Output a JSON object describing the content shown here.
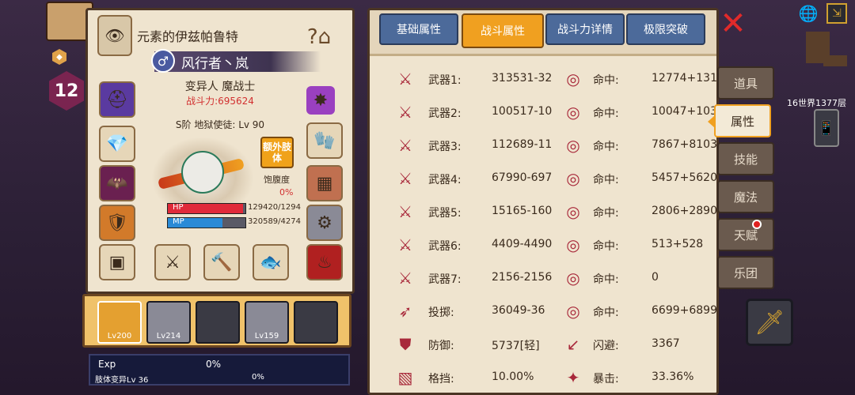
{
  "character": {
    "name": "元素的伊兹帕鲁特",
    "class": "风行者丶岚",
    "race": "变异人 魔战士",
    "power_label": "战斗力:695624",
    "rank": "S阶 地狱使徒: Lv 90",
    "extra_limb_label": "额外肢体",
    "satiety_label": "饱腹度",
    "satiety_value": "0%",
    "hp_label": "HP",
    "hp_value": "129420/1294",
    "hp_fraction": 0.97,
    "mp_label": "MP",
    "mp_value": "320589/4274",
    "mp_fraction": 0.7
  },
  "team": [
    {
      "level": "Lv200",
      "state": "active"
    },
    {
      "level": "Lv214",
      "state": "filled"
    },
    {
      "level": "",
      "state": "empty"
    },
    {
      "level": "Lv159",
      "state": "filled"
    },
    {
      "level": "",
      "state": "empty"
    }
  ],
  "exp": {
    "label": "Exp",
    "value": "0%",
    "sub_label": "肢体变异Lv 36",
    "sub_value": "0%"
  },
  "tabs": [
    {
      "label": "基础属性",
      "active": false
    },
    {
      "label": "战斗属性",
      "active": true
    },
    {
      "label": "战斗力详情",
      "active": false
    },
    {
      "label": "极限突破",
      "active": false
    }
  ],
  "stats": [
    {
      "icon": "sword-icon",
      "label": "武器1:",
      "value": "313531-32",
      "icon2": "target-icon",
      "label2": "命中:",
      "value2": "12774+131"
    },
    {
      "icon": "sword-icon",
      "label": "武器2:",
      "value": "100517-10",
      "icon2": "target-icon",
      "label2": "命中:",
      "value2": "10047+103"
    },
    {
      "icon": "sword-icon",
      "label": "武器3:",
      "value": "112689-11",
      "icon2": "target-icon",
      "label2": "命中:",
      "value2": "7867+8103"
    },
    {
      "icon": "sword-icon",
      "label": "武器4:",
      "value": "67990-697",
      "icon2": "target-icon",
      "label2": "命中:",
      "value2": "5457+5620"
    },
    {
      "icon": "sword-icon",
      "label": "武器5:",
      "value": "15165-160",
      "icon2": "target-icon",
      "label2": "命中:",
      "value2": "2806+2890"
    },
    {
      "icon": "sword-icon",
      "label": "武器6:",
      "value": "4409-4490",
      "icon2": "target-icon",
      "label2": "命中:",
      "value2": "513+528"
    },
    {
      "icon": "sword-icon",
      "label": "武器7:",
      "value": "2156-2156",
      "icon2": "target-icon",
      "label2": "命中:",
      "value2": "0"
    },
    {
      "icon": "bow-icon",
      "label": "投掷:",
      "value": "36049-36",
      "icon2": "target-icon",
      "label2": "命中:",
      "value2": "6699+6899"
    },
    {
      "icon": "shield-icon",
      "label": "防御:",
      "value": "5737[轻]",
      "icon2": "dodge-icon",
      "label2": "闪避:",
      "value2": "3367"
    },
    {
      "icon": "block-icon",
      "label": "格挡:",
      "value": "10.00%",
      "icon2": "crit-icon",
      "label2": "暴击:",
      "value2": "33.36%"
    }
  ],
  "side_menu": [
    {
      "label": "道具",
      "active": false
    },
    {
      "label": "属性",
      "active": true
    },
    {
      "label": "技能",
      "active": false
    },
    {
      "label": "魔法",
      "active": false
    },
    {
      "label": "天赋",
      "active": false
    },
    {
      "label": "乐团",
      "active": false
    }
  ],
  "hud": {
    "hex_level": "12",
    "floor_text": "16世界1377层"
  },
  "colors": {
    "panel_bg": "#efe4cf",
    "tab_blue": "#4c6a9a",
    "tab_active": "#f0a020",
    "stat_icon_red": "#a8283a",
    "power_red": "#d23030"
  }
}
